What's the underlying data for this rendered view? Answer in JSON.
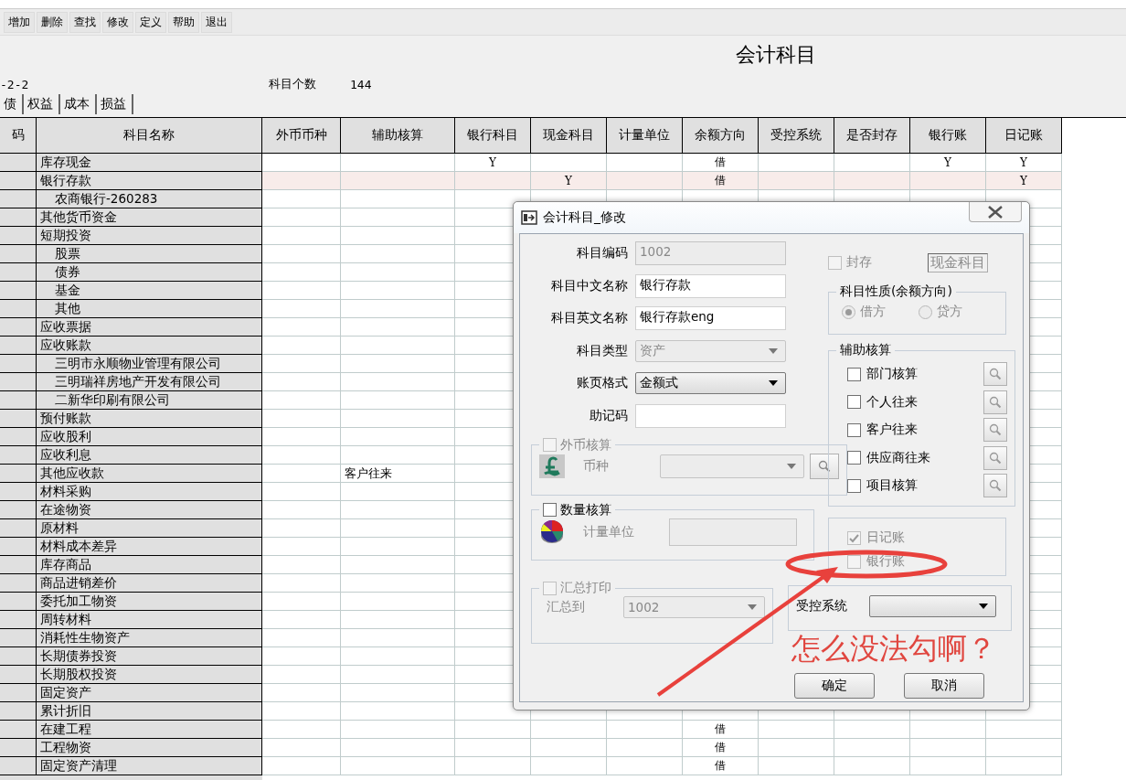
{
  "toolbar": [
    "增加",
    "删除",
    "查找",
    "修改",
    "定义",
    "帮助",
    "退出"
  ],
  "title": "会计科目",
  "info": {
    "date_fragment": "-2-2",
    "count_label": "科目个数",
    "count": "144"
  },
  "tabs": [
    {
      "label": "债",
      "selected": false
    },
    {
      "label": "权益",
      "selected": false
    },
    {
      "label": "成本",
      "selected": false
    },
    {
      "label": "损益",
      "selected": false
    }
  ],
  "table": {
    "columns": [
      "码",
      "科目名称",
      "外币币种",
      "辅助核算",
      "银行科目",
      "现金科目",
      "计量单位",
      "余额方向",
      "受控系统",
      "是否封存",
      "银行账",
      "日记账"
    ],
    "rows": [
      {
        "name": "库存现金",
        "selected": false,
        "bank_subject": "Y",
        "balance_direction": "借",
        "bank_book": "Y",
        "journal": "Y"
      },
      {
        "name": "银行存款",
        "selected": true,
        "cash_subject": "Y",
        "balance_direction": "借",
        "journal": "Y",
        "children": [
          {
            "name": "农商银行-260283",
            "selected": false
          }
        ]
      },
      {
        "name": "其他货币资金",
        "selected": false
      },
      {
        "name": "短期投资",
        "selected": false,
        "children": [
          {
            "name": "股票",
            "selected": false
          },
          {
            "name": "债券",
            "selected": false
          },
          {
            "name": "基金",
            "selected": false
          },
          {
            "name": "其他",
            "selected": false
          }
        ]
      },
      {
        "name": "应收票据",
        "selected": false
      },
      {
        "name": "应收账款",
        "selected": false,
        "children": [
          {
            "name": "三明市永顺物业管理有限公司",
            "selected": false
          },
          {
            "name": "三明瑞祥房地产开发有限公司",
            "selected": false
          },
          {
            "name": "二新华印刷有限公司",
            "selected": false
          }
        ]
      },
      {
        "name": "预付账款",
        "selected": false
      },
      {
        "name": "应收股利",
        "selected": false
      },
      {
        "name": "应收利息",
        "selected": false
      },
      {
        "name": "其他应收款",
        "selected": false,
        "auxiliary": "客户往来"
      },
      {
        "name": "材料采购",
        "selected": false
      },
      {
        "name": "在途物资",
        "selected": false
      },
      {
        "name": "原材料",
        "selected": false
      },
      {
        "name": "材料成本差异",
        "selected": false
      },
      {
        "name": "库存商品",
        "selected": false
      },
      {
        "name": "商品进销差价",
        "selected": false
      },
      {
        "name": "委托加工物资",
        "selected": false
      },
      {
        "name": "周转材料",
        "selected": false
      },
      {
        "name": "消耗性生物资产",
        "selected": false
      },
      {
        "name": "长期债券投资",
        "selected": false
      },
      {
        "name": "长期股权投资",
        "selected": false
      },
      {
        "name": "固定资产",
        "selected": false
      },
      {
        "name": "累计折旧",
        "selected": false
      },
      {
        "name": "在建工程",
        "selected": false,
        "balance_direction": "借"
      },
      {
        "name": "工程物资",
        "selected": false,
        "balance_direction": "借"
      },
      {
        "name": "固定资产清理",
        "selected": false,
        "balance_direction": "借"
      }
    ]
  },
  "dialog": {
    "title": "会计科目_修改",
    "fields": [
      {
        "label": "科目编码",
        "kind": "text",
        "value": "1002",
        "disabled": true
      },
      {
        "label": "科目中文名称",
        "kind": "text",
        "value": "银行存款",
        "disabled": false
      },
      {
        "label": "科目英文名称",
        "kind": "text",
        "value": "银行存款eng",
        "disabled": false
      },
      {
        "label": "科目类型",
        "kind": "select",
        "value": "资产",
        "disabled": true
      },
      {
        "label": "账页格式",
        "kind": "select",
        "value": "金额式",
        "disabled": false
      },
      {
        "label": "助记码",
        "kind": "text",
        "disabled": false
      }
    ],
    "archive": {
      "label": "封存",
      "checked": false,
      "disabled": true
    },
    "subject_badge": "现金科目",
    "nature": {
      "title": "科目性质(余额方向)",
      "disabled": true,
      "options": [
        {
          "label": "借方",
          "selected": true
        },
        {
          "label": "贷方",
          "selected": false
        }
      ]
    },
    "auxiliary": {
      "title": "辅助核算",
      "items": [
        {
          "label": "部门核算",
          "checked": false
        },
        {
          "label": "个人往来",
          "checked": false
        },
        {
          "label": "客户往来",
          "checked": false
        },
        {
          "label": "供应商往来",
          "checked": false
        },
        {
          "label": "项目核算",
          "checked": false
        }
      ]
    },
    "foreign": {
      "title": "外币核算",
      "checked": false,
      "disabled": true,
      "field_label": "币种"
    },
    "quantity": {
      "title": "数量核算",
      "checked": false,
      "disabled": false,
      "field_label": "计量单位"
    },
    "books": [
      {
        "label": "日记账",
        "checked": true,
        "disabled": true
      },
      {
        "label": "银行账",
        "checked": false,
        "disabled": true
      }
    ],
    "summary": {
      "title": "汇总打印",
      "checked": false,
      "disabled": true,
      "field_label": "汇总到",
      "value": "1002"
    },
    "controlled": {
      "label": "受控系统"
    },
    "buttons": [
      "确定",
      "取消"
    ]
  },
  "annotation": {
    "text": "怎么没法勾啊？"
  }
}
